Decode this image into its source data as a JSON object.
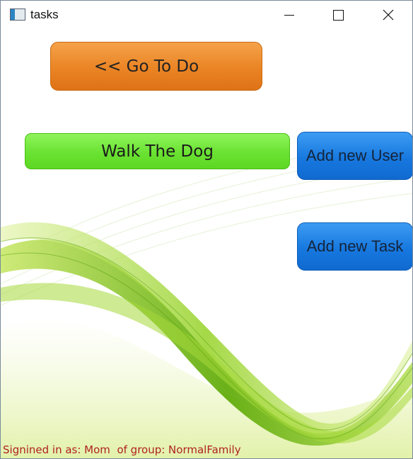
{
  "window": {
    "title": "tasks",
    "icon": "app-window-icon"
  },
  "controls": {
    "minimize_icon": "minimize-icon",
    "maximize_icon": "maximize-icon",
    "close_icon": "close-icon"
  },
  "main": {
    "go_to_do_label": "<< Go To Do",
    "task_item_label": "Walk The Dog",
    "add_user_label": "Add new User",
    "add_task_label": "Add new Task"
  },
  "status": {
    "signed_in_text": "Signined in as: Mom  of group: NormalFamily"
  },
  "colors": {
    "orange_button": "#ea8424",
    "green_button": "#6ae232",
    "blue_button": "#1778df",
    "status_text": "#b02222",
    "wave_green": "#7ab800"
  }
}
